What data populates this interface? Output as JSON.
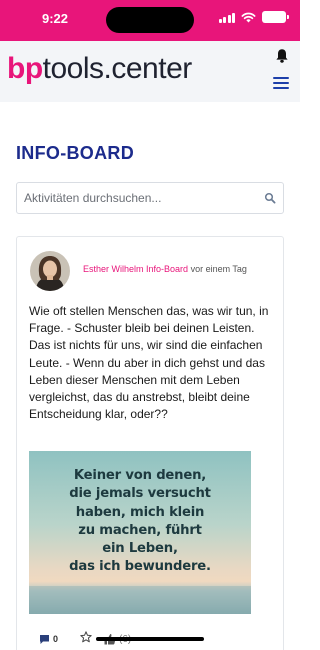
{
  "status_bar": {
    "time": "9:22",
    "background": "#e8157a",
    "icons": [
      "signal-icon",
      "wifi-icon",
      "battery-icon"
    ]
  },
  "header": {
    "logo_bp": "bp",
    "logo_rest": "tools.center",
    "icons": [
      "bell-icon",
      "menu-icon"
    ]
  },
  "page": {
    "title": "INFO-BOARD"
  },
  "search": {
    "placeholder": "Aktivitäten durchsuchen...",
    "value": ""
  },
  "activity": {
    "author": "Esther Wilhelm",
    "group": "Info-Board",
    "time": "vor einem Tag",
    "text": "Wie oft stellen Menschen das, was wir tun, in Frage. - Schuster bleib bei deinen Leisten. Das ist nichts für uns, wir sind die einfachen Leute. - Wenn du aber in dich gehst und das Leben dieser Menschen mit dem Leben vergleichst, das du anstrebst, bleibt deine Entscheidung klar, oder??",
    "image_quote": {
      "lines": [
        "Keiner von denen,",
        "die jemals versucht",
        "haben, mich klein",
        "zu machen, führt",
        "ein Leben,",
        "das ich bewundere."
      ]
    },
    "comment_count": "0",
    "like_count": "(6)"
  },
  "colors": {
    "brand": "#e8157a",
    "title": "#1c2b8c",
    "menu": "#1c3faa"
  }
}
